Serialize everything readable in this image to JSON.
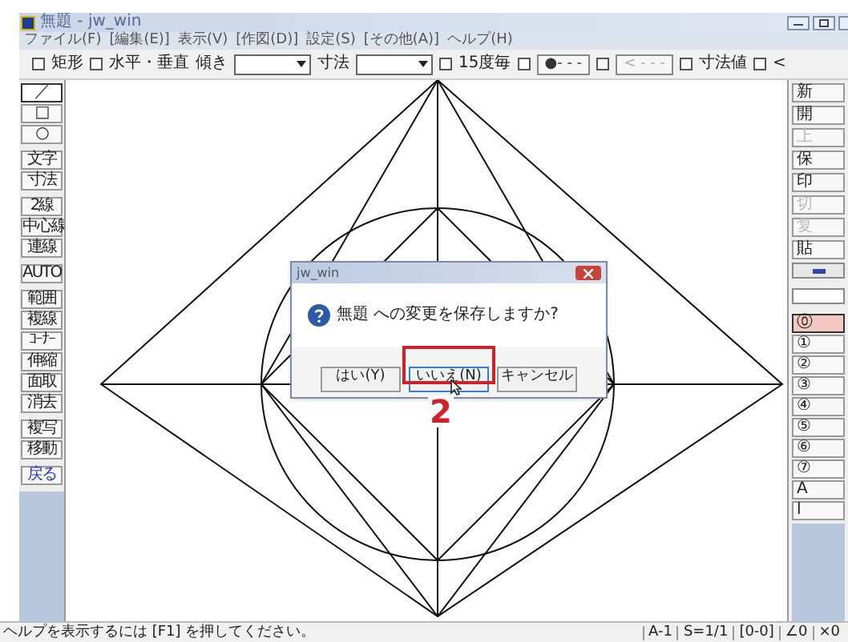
{
  "window": {
    "title": "無題 - jw_win"
  },
  "menu": [
    "ファイル(F)",
    "[編集(E)]",
    "表示(V)",
    "[作図(D)]",
    "設定(S)",
    "[その他(A)]",
    "ヘルプ(H)"
  ],
  "toolbar": [
    {
      "kind": "checkbox",
      "label": "矩形",
      "checked": false
    },
    {
      "kind": "checkbox",
      "label": "水平・垂直",
      "checked": false
    },
    {
      "kind": "label",
      "label": "傾き"
    },
    {
      "kind": "select"
    },
    {
      "kind": "label",
      "label": "寸法"
    },
    {
      "kind": "select"
    },
    {
      "kind": "checkbox",
      "label": "15度毎",
      "checked": false
    },
    {
      "kind": "checkbox",
      "checked": false
    },
    {
      "kind": "button",
      "label": "●- - -",
      "disabled": false
    },
    {
      "kind": "checkbox",
      "checked": false
    },
    {
      "kind": "button",
      "label": "< - - -",
      "disabled": true
    },
    {
      "kind": "checkbox",
      "label": "寸法値",
      "checked": false
    },
    {
      "kind": "checkbox",
      "label": "<",
      "checked": false
    }
  ],
  "left_tool_groups": [
    [
      {
        "label": "／",
        "selected": true
      },
      {
        "label": "□",
        "selected": false
      },
      {
        "label": "○",
        "selected": false
      }
    ],
    [
      {
        "label": "文字",
        "selected": false
      },
      {
        "label": "寸法",
        "selected": false
      }
    ],
    [
      {
        "label": "2線",
        "selected": false
      },
      {
        "label": "中心線",
        "selected": false
      },
      {
        "label": "連線",
        "selected": false
      }
    ],
    [
      {
        "label": "AUTO",
        "selected": false
      }
    ],
    [
      {
        "label": "範囲",
        "selected": false
      },
      {
        "label": "複線",
        "selected": false
      },
      {
        "label": "ｺｰﾅｰ",
        "selected": false
      },
      {
        "label": "伸縮",
        "selected": false
      },
      {
        "label": "面取",
        "selected": false
      },
      {
        "label": "消去",
        "selected": false
      }
    ],
    [
      {
        "label": "複写",
        "selected": false
      },
      {
        "label": "移動",
        "selected": false
      }
    ],
    [
      {
        "label": "戻る",
        "selected": false,
        "kind": "undo"
      }
    ]
  ],
  "right_tools": [
    {
      "label": "新",
      "disabled": false
    },
    {
      "label": "開",
      "disabled": false
    },
    {
      "label": "上",
      "disabled": true
    },
    {
      "label": "保",
      "disabled": false
    },
    {
      "label": "印",
      "disabled": false
    },
    {
      "label": "切",
      "disabled": true
    },
    {
      "label": "复",
      "disabled": true
    },
    {
      "label": "貼",
      "disabled": false
    }
  ],
  "layers": [
    {
      "label": "⓪",
      "selected": true
    },
    {
      "label": "①",
      "selected": false
    },
    {
      "label": "②",
      "selected": false
    },
    {
      "label": "③",
      "selected": false
    },
    {
      "label": "④",
      "selected": false
    },
    {
      "label": "⑤",
      "selected": false
    },
    {
      "label": "⑥",
      "selected": false
    },
    {
      "label": "⑦",
      "selected": false
    },
    {
      "label": "A",
      "selected": false
    },
    {
      "label": "l",
      "selected": false
    }
  ],
  "dialog": {
    "title": "jw_win",
    "message": "無題 への変更を保存しますか?",
    "buttons": [
      {
        "label": "はい(Y)",
        "focused": false,
        "highlighted": false
      },
      {
        "label": "いいえ(N)",
        "focused": true,
        "highlighted": true
      },
      {
        "label": "キャンセル",
        "focused": false,
        "highlighted": false
      }
    ],
    "annotation": "2"
  },
  "status_bar": {
    "help": "ヘルプを表示するには [F1] を押してください。",
    "fields": [
      "A-1",
      "S=1/1",
      "[0-0]",
      "∠0",
      "×0"
    ]
  }
}
